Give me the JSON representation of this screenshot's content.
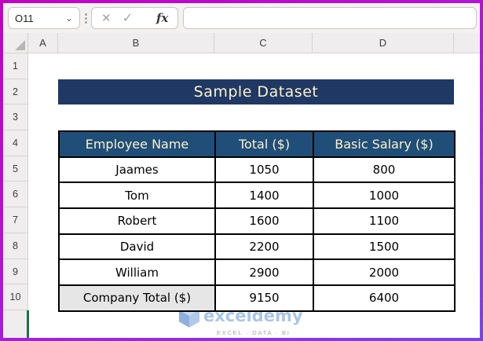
{
  "colors": {
    "frame_gradient_start": "#C203C2",
    "frame_gradient_end": "#7644EF",
    "banner_bg": "#1F3864",
    "table_header_bg": "#1F4E79",
    "header_text": "#FFF2CC",
    "total_label_bg": "#E7E6E6",
    "sheet_accent_green": "#1E7145",
    "watermark_blue": "#A9C6E6"
  },
  "topbar": {
    "name_box_value": "O11",
    "formula_value": ""
  },
  "icons": {
    "chevron_down": "⌄",
    "drag_dots": "⋮",
    "cancel": "✕",
    "enter": "✓",
    "function": "fx"
  },
  "sheet": {
    "column_headers": [
      "A",
      "B",
      "C",
      "D"
    ],
    "row_numbers": [
      "1",
      "2",
      "3",
      "4",
      "5",
      "6",
      "7",
      "8",
      "9",
      "10"
    ]
  },
  "banner": {
    "title": "Sample Dataset"
  },
  "table": {
    "headers": [
      "Employee Name",
      "Total ($)",
      "Basic Salary ($)"
    ],
    "rows": [
      {
        "name": "Jaames",
        "total": "1050",
        "basic": "800"
      },
      {
        "name": "Tom",
        "total": "1400",
        "basic": "1000"
      },
      {
        "name": "Robert",
        "total": "1600",
        "basic": "1100"
      },
      {
        "name": "David",
        "total": "2200",
        "basic": "1500"
      },
      {
        "name": "William",
        "total": "2900",
        "basic": "2000"
      }
    ],
    "total_row": {
      "name": "Company Total ($)",
      "total": "9150",
      "basic": "6400"
    }
  },
  "watermark": {
    "brand": "exceldemy",
    "tagline": "EXCEL · DATA · BI"
  }
}
